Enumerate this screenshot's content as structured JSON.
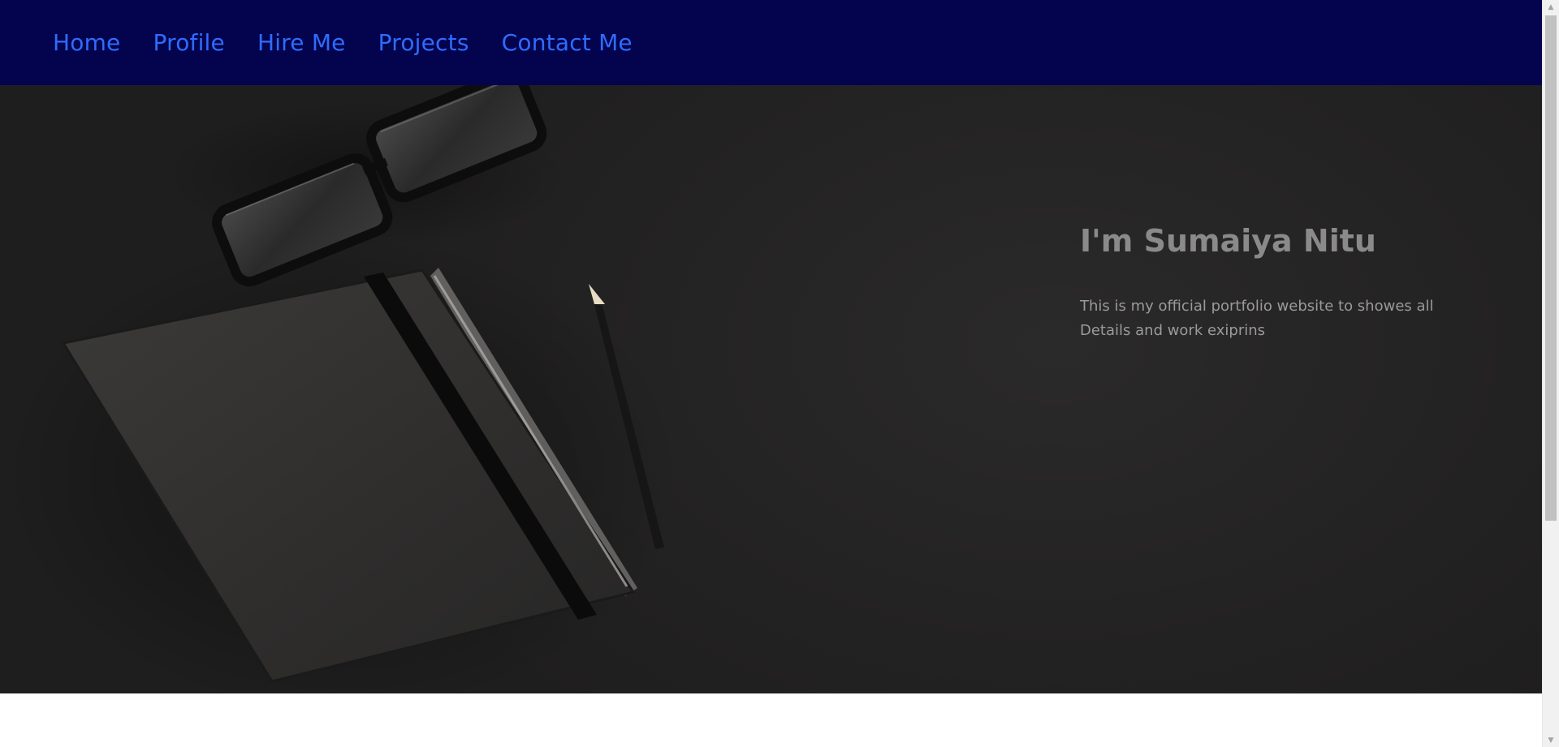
{
  "nav": {
    "items": [
      {
        "label": "Home"
      },
      {
        "label": "Profile"
      },
      {
        "label": "Hire Me"
      },
      {
        "label": "Projects"
      },
      {
        "label": "Contact Me"
      }
    ]
  },
  "hero": {
    "title": "I'm Sumaiya Nitu",
    "description": "This is my official portfolio website to showes all Details and work exiprins"
  },
  "icons": {
    "scroll_up": "chevron-up-icon",
    "scroll_down": "chevron-down-icon"
  },
  "colors": {
    "navbar_bg": "#04044e",
    "nav_link": "#2f6bff",
    "hero_bg": "#242323",
    "hero_title": "#8a8a8a",
    "hero_text": "#9a9a9a"
  },
  "scrollbar": {
    "position": 0
  }
}
